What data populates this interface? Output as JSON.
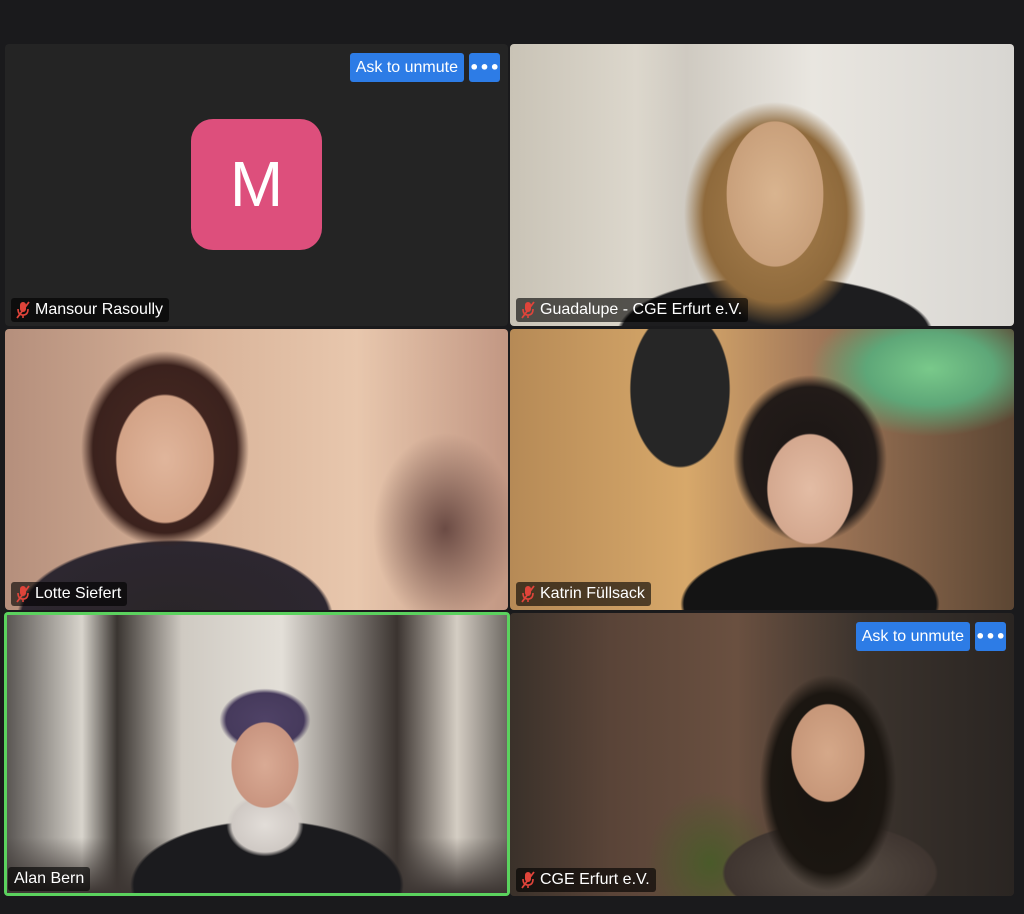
{
  "colors": {
    "background": "#1a1a1c",
    "active_speaker_border": "#5bd25e",
    "button_blue": "#2d7ce6",
    "avatar_pink": "#dd4f7c",
    "muted_mic_red": "#e0443a"
  },
  "participants": [
    {
      "name": "Mansour Rasoully",
      "avatar_letter": "M",
      "muted": true,
      "video": false,
      "unmute_label": "Ask to unmute",
      "more_label": "•••"
    },
    {
      "name": "Guadalupe - CGE Erfurt e.V.",
      "muted": true,
      "video": true
    },
    {
      "name": "Lotte Siefert",
      "muted": true,
      "video": true
    },
    {
      "name": "Katrin Füllsack",
      "muted": true,
      "video": true
    },
    {
      "name": "Alan Bern",
      "muted": false,
      "video": true,
      "active_speaker": true
    },
    {
      "name": "CGE Erfurt e.V.",
      "muted": true,
      "video": true,
      "unmute_label": "Ask to unmute",
      "more_label": "•••"
    }
  ],
  "icons": {
    "muted_mic": "muted-microphone-icon",
    "more": "more-options-icon"
  }
}
